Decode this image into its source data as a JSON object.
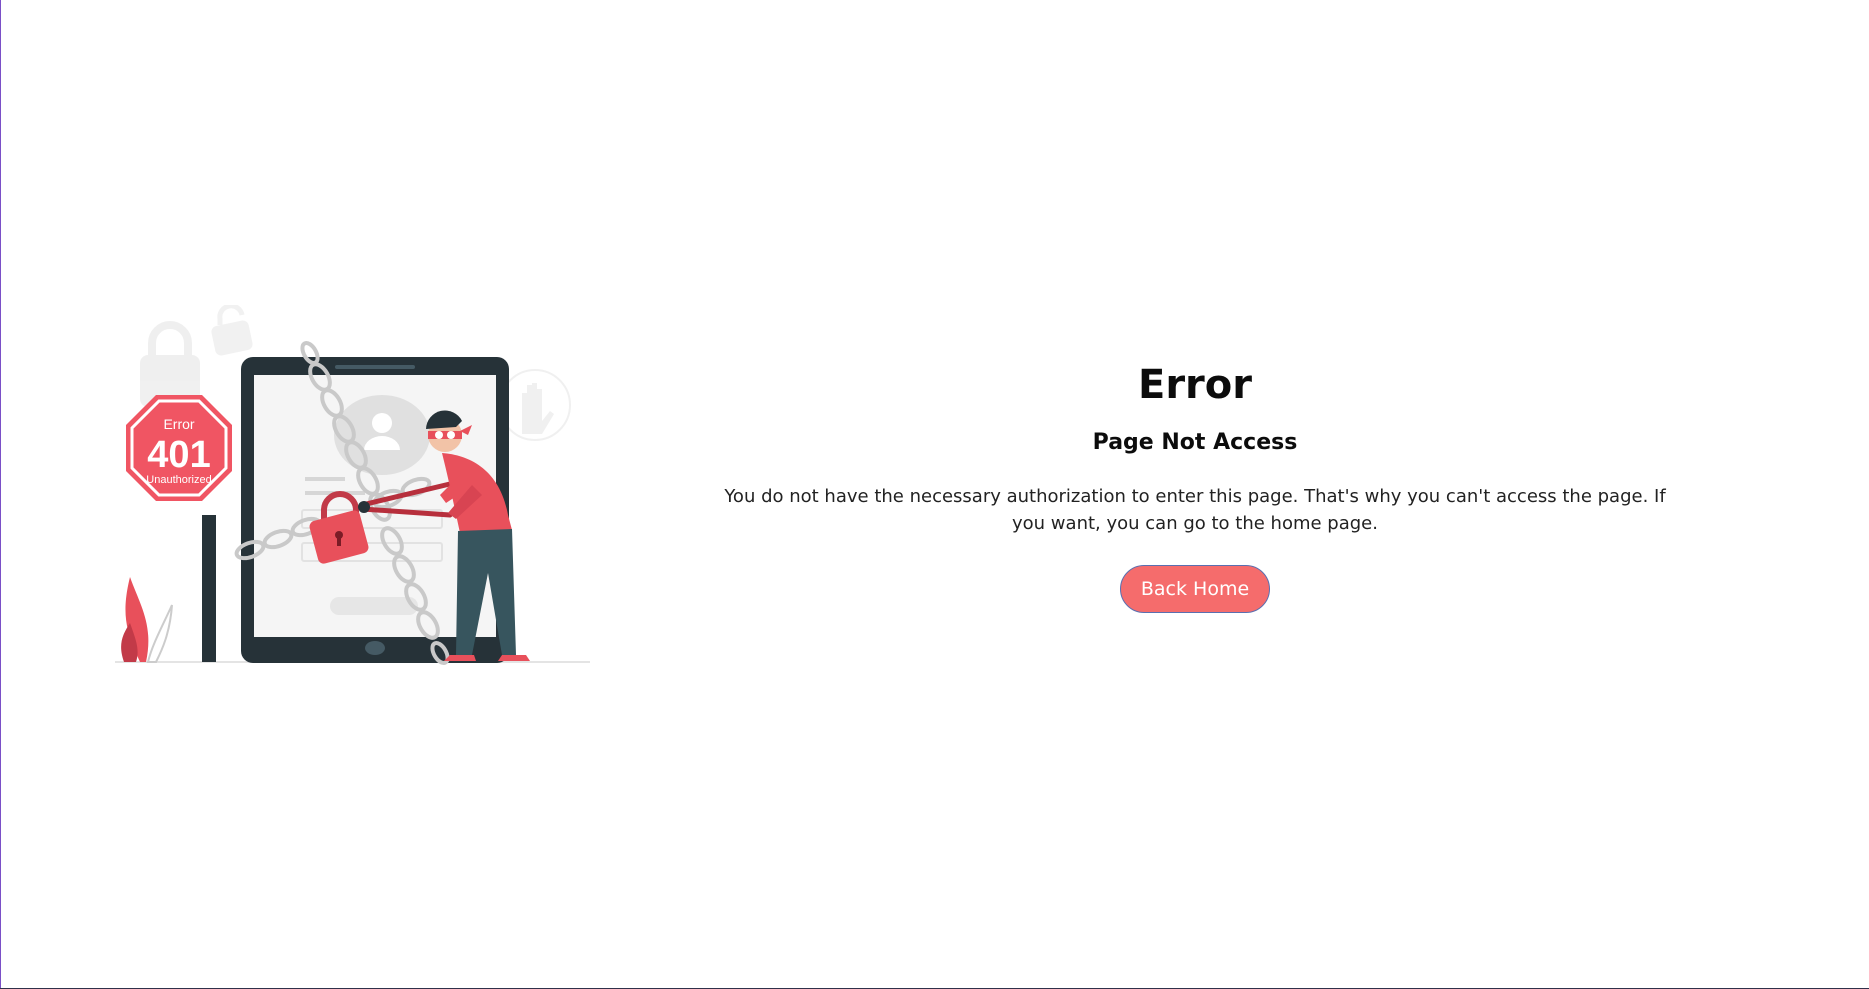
{
  "illustration": {
    "sign": {
      "top_label": "Error",
      "code": "401",
      "bottom_label": "Unauthorized"
    },
    "icon": "unauthorized-person-cutting-chain-illustration",
    "colors": {
      "accent": "#f05563",
      "dark": "#263238",
      "chain": "#ffffff"
    }
  },
  "main": {
    "title": "Error",
    "subtitle": "Page Not Access",
    "message": "You do not have the necessary authorization to enter this page. That's why you can't access the page. If you want, you can go to the home page.",
    "button_label": "Back Home"
  },
  "colors": {
    "button_bg": "#f56c6c",
    "button_border": "#5a6fb0",
    "button_text": "#ffffff"
  }
}
